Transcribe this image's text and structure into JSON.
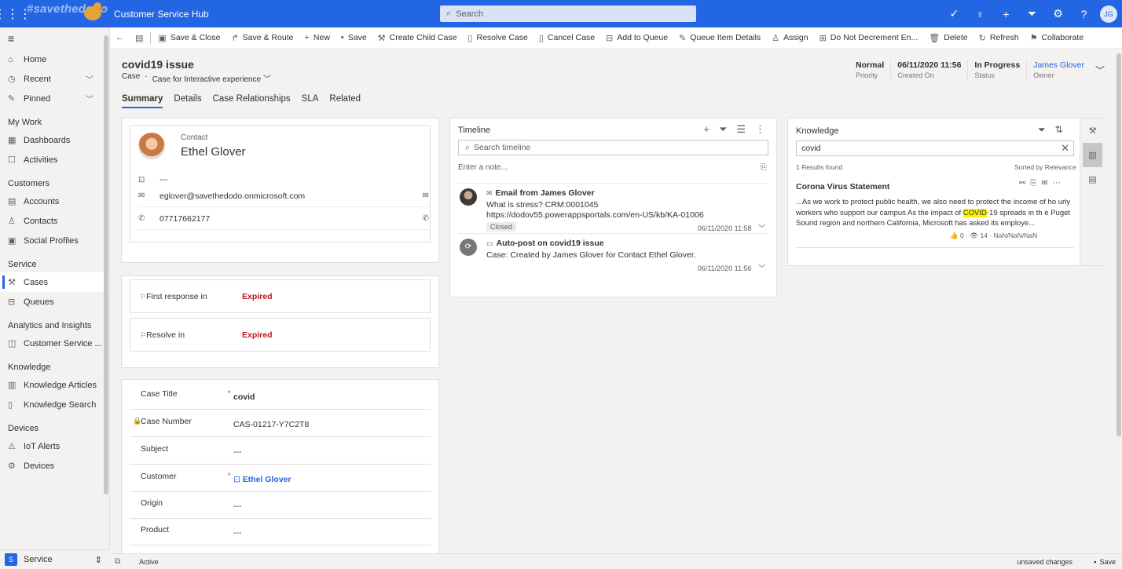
{
  "topbar": {
    "brand": "#savethedodo",
    "app_title": "Customer Service Hub",
    "search_placeholder": "Search",
    "user_initials": "JG",
    "icons": [
      "task-icon",
      "lightbulb-icon",
      "plus-icon",
      "filter-icon",
      "gear-icon",
      "help-icon"
    ]
  },
  "nav": {
    "items_top": [
      {
        "label": "Home",
        "icon": "home-icon"
      },
      {
        "label": "Recent",
        "icon": "clock-icon",
        "expandable": true
      },
      {
        "label": "Pinned",
        "icon": "pin-icon",
        "expandable": true
      }
    ],
    "groups": [
      {
        "title": "My Work",
        "items": [
          {
            "label": "Dashboards"
          },
          {
            "label": "Activities"
          }
        ]
      },
      {
        "title": "Customers",
        "items": [
          {
            "label": "Accounts"
          },
          {
            "label": "Contacts"
          },
          {
            "label": "Social Profiles"
          }
        ]
      },
      {
        "title": "Service",
        "items": [
          {
            "label": "Cases",
            "selected": true
          },
          {
            "label": "Queues"
          }
        ]
      },
      {
        "title": "Analytics and Insights",
        "items": [
          {
            "label": "Customer Service ..."
          }
        ]
      },
      {
        "title": "Knowledge",
        "items": [
          {
            "label": "Knowledge Articles"
          },
          {
            "label": "Knowledge Search"
          }
        ]
      },
      {
        "title": "Devices",
        "items": [
          {
            "label": "IoT Alerts"
          },
          {
            "label": "Devices"
          }
        ]
      }
    ],
    "area": {
      "badge": "S",
      "label": "Service"
    }
  },
  "commands": [
    "Save & Close",
    "Save & Route",
    "New",
    "Save",
    "Create Child Case",
    "Resolve Case",
    "Cancel Case",
    "Add to Queue",
    "Queue Item Details",
    "Assign",
    "Do Not Decrement En...",
    "Delete",
    "Refresh",
    "Collaborate"
  ],
  "record": {
    "title": "covid19 issue",
    "entity": "Case",
    "form": "Case for Interactive experience",
    "header": {
      "priority": {
        "value": "Normal",
        "label": "Priority"
      },
      "created_on": {
        "value": "06/11/2020 11:56",
        "label": "Created On"
      },
      "status": {
        "value": "In Progress",
        "label": "Status"
      },
      "owner": {
        "value": "James Glover",
        "label": "Owner"
      }
    },
    "tabs": [
      "Summary",
      "Details",
      "Case Relationships",
      "SLA",
      "Related"
    ]
  },
  "contact": {
    "label": "Contact",
    "name": "Ethel Glover",
    "title_value": "---",
    "email": "eglover@savethedodo.onmicrosoft.com",
    "phone": "07717662177"
  },
  "sla": [
    {
      "label": "First response in",
      "value": "Expired"
    },
    {
      "label": "Resolve in",
      "value": "Expired"
    }
  ],
  "fields": [
    {
      "label": "Case Title",
      "required": true,
      "value": "covid"
    },
    {
      "label": "Case Number",
      "locked": true,
      "value": "CAS-01217-Y7C2T8"
    },
    {
      "label": "Subject",
      "value": "---"
    },
    {
      "label": "Customer",
      "required": true,
      "value": "Ethel Glover"
    },
    {
      "label": "Origin",
      "value": "---"
    },
    {
      "label": "Product",
      "value": "---"
    }
  ],
  "timeline": {
    "title": "Timeline",
    "search_placeholder": "Search timeline",
    "note_placeholder": "Enter a note...",
    "entries": [
      {
        "title": "Email from James Glover",
        "line1": "What is stress? CRM:0001045",
        "line2": "https://dodov55.powerappsportals.com/en-US/kb/KA-01006",
        "badge": "Closed",
        "time": "06/11/2020 11:58"
      },
      {
        "title": "Auto-post on covid19 issue",
        "line1": "Case: Created by James Glover for Contact Ethel Glover.",
        "time": "06/11/2020 11:56"
      }
    ]
  },
  "knowledge": {
    "title": "Knowledge",
    "query": "covid",
    "results": "1 Results found",
    "sort": "Sorted by Relevance",
    "article_title": "Corona Virus Statement",
    "snippet_1": "...As we work to protect public health, we also need to protect the income of ho urly workers who support our campus As the impact of ",
    "snippet_hl": "COVID",
    "snippet_2": "-19 spreads in th e Puget Sound region and northern California, Microsoft has asked its employe...",
    "likes": "0",
    "views": "14",
    "date": "NaN/NaN/NaN"
  },
  "statusbar": {
    "state": "Active",
    "unsaved": "unsaved changes",
    "save": "Save"
  },
  "colors": {
    "brand": "#2266e3",
    "expired": "#c50f1f",
    "highlight": "#fff100"
  }
}
